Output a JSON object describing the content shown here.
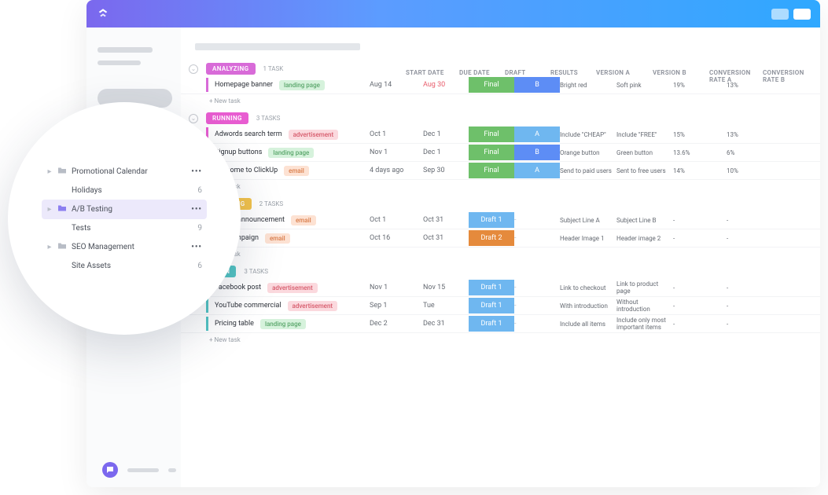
{
  "columns": {
    "start_date": "START DATE",
    "due_date": "DUE DATE",
    "draft": "DRAFT",
    "results": "RESULTS",
    "version_a": "VERSION A",
    "version_b": "VERSION B",
    "conv_a": "CONVERSION RATE A",
    "conv_b": "CONVERSION RATE B"
  },
  "new_task_label": "+ New task",
  "groups": [
    {
      "id": "analyzing",
      "label": "ANALYZING",
      "color": "#d86bd8",
      "bar_color": "#d86bd8",
      "count_label": "1 TASK",
      "tasks": [
        {
          "name": "Homepage banner",
          "tag": {
            "text": "landing page",
            "bg": "#d6f2dc",
            "fg": "#5aa66b"
          },
          "start": "Aug 14",
          "due": "Aug 30",
          "due_overdue": true,
          "draft": {
            "text": "Final",
            "bg": "#6ec06a"
          },
          "results": {
            "text": "B",
            "bg": "#5d8df5"
          },
          "va": "Bright red",
          "vb": "Soft pink",
          "ca": "19%",
          "cb": "13%"
        }
      ]
    },
    {
      "id": "running",
      "label": "RUNNING",
      "color": "#e85dd1",
      "bar_color": "#e85dd1",
      "count_label": "3 TASKS",
      "tasks": [
        {
          "name": "Adwords search term",
          "tag": {
            "text": "advertisement",
            "bg": "#fbd9de",
            "fg": "#d65a6b"
          },
          "start": "Oct 1",
          "due": "Dec 1",
          "draft": {
            "text": "Final",
            "bg": "#6ec06a"
          },
          "results": {
            "text": "A",
            "bg": "#6fb7f0"
          },
          "va": "Include \"CHEAP\"",
          "vb": "Include \"FREE\"",
          "ca": "15%",
          "cb": "13%"
        },
        {
          "name": "Signup buttons",
          "tag": {
            "text": "landing page",
            "bg": "#d6f2dc",
            "fg": "#5aa66b"
          },
          "start": "Nov 1",
          "due": "Dec 1",
          "draft": {
            "text": "Final",
            "bg": "#6ec06a"
          },
          "results": {
            "text": "B",
            "bg": "#5d8df5"
          },
          "va": "Orange button",
          "vb": "Green button",
          "ca": "13.6%",
          "cb": "6%"
        },
        {
          "name": "Welcome to ClickUp",
          "tag": {
            "text": "email",
            "bg": "#fde2d3",
            "fg": "#d97b48"
          },
          "start": "4 days ago",
          "due": "Sep 30",
          "draft": {
            "text": "Final",
            "bg": "#6ec06a"
          },
          "results": {
            "text": "A",
            "bg": "#6fb7f0"
          },
          "va": "Send to paid users",
          "vb": "Sent to free users",
          "ca": "14%",
          "cb": "10%"
        }
      ]
    },
    {
      "id": "drafting",
      "label": "DRAFTING",
      "color": "#f2c24b",
      "bar_color": "#f2c24b",
      "count_label": "2 TASKS",
      "tasks": [
        {
          "name": "Promo announcement",
          "tag": {
            "text": "email",
            "bg": "#fde2d3",
            "fg": "#d97b48"
          },
          "start": "Oct 1",
          "due": "Oct 31",
          "draft": {
            "text": "Draft 1",
            "bg": "#6fb7f0"
          },
          "results": {
            "text": "-",
            "bg": ""
          },
          "va": "Subject Line A",
          "vb": "Subject Line B",
          "ca": "-",
          "cb": "-"
        },
        {
          "name": "Fall campaign",
          "tag": {
            "text": "email",
            "bg": "#fde2d3",
            "fg": "#d97b48"
          },
          "start": "Oct 16",
          "due": "Oct 31",
          "draft": {
            "text": "Draft 2",
            "bg": "#e58a3c"
          },
          "results": {
            "text": "-",
            "bg": ""
          },
          "va": "Header Image 1",
          "vb": "Header image 2",
          "ca": "-",
          "cb": "-"
        }
      ]
    },
    {
      "id": "open",
      "label": "OPEN",
      "color": "#52c4c4",
      "bar_color": "#52c4c4",
      "count_label": "3 TASKS",
      "tasks": [
        {
          "name": "Facebook post",
          "tag": {
            "text": "advertisement",
            "bg": "#fbd9de",
            "fg": "#d65a6b"
          },
          "start": "Nov 1",
          "due": "Nov 15",
          "draft": {
            "text": "Draft 1",
            "bg": "#6fb7f0"
          },
          "results": {
            "text": "-",
            "bg": ""
          },
          "va": "Link to checkout",
          "vb": "Link to product page",
          "ca": "-",
          "cb": "-"
        },
        {
          "name": "YouTube commercial",
          "tag": {
            "text": "advertisement",
            "bg": "#fbd9de",
            "fg": "#d65a6b"
          },
          "start": "Sep 1",
          "due": "Tue",
          "draft": {
            "text": "Draft 1",
            "bg": "#6fb7f0"
          },
          "results": {
            "text": "-",
            "bg": ""
          },
          "va": "With introduction",
          "vb": "Without introduction",
          "ca": "-",
          "cb": "-"
        },
        {
          "name": "Pricing table",
          "tag": {
            "text": "landing page",
            "bg": "#d6f2dc",
            "fg": "#5aa66b"
          },
          "start": "Dec 2",
          "due": "Dec 31",
          "draft": {
            "text": "Draft 1",
            "bg": "#6fb7f0"
          },
          "results": {
            "text": "-",
            "bg": ""
          },
          "va": "Include all items",
          "vb": "Include only most important items",
          "ca": "-",
          "cb": "-"
        }
      ]
    }
  ],
  "sidebar_nav": {
    "items": [
      {
        "name": "Promotional Calendar",
        "type": "folder",
        "caret": true,
        "right": "more"
      },
      {
        "name": "Holidays",
        "type": "list",
        "child": true,
        "right": "6"
      },
      {
        "name": "A/B Testing",
        "type": "folder",
        "caret": true,
        "active": true,
        "right": "more"
      },
      {
        "name": "Tests",
        "type": "list",
        "child": true,
        "right": "9"
      },
      {
        "name": "SEO Management",
        "type": "folder",
        "caret": true,
        "right": "more"
      },
      {
        "name": "Site Assets",
        "type": "list",
        "child": true,
        "right": "6"
      }
    ]
  }
}
